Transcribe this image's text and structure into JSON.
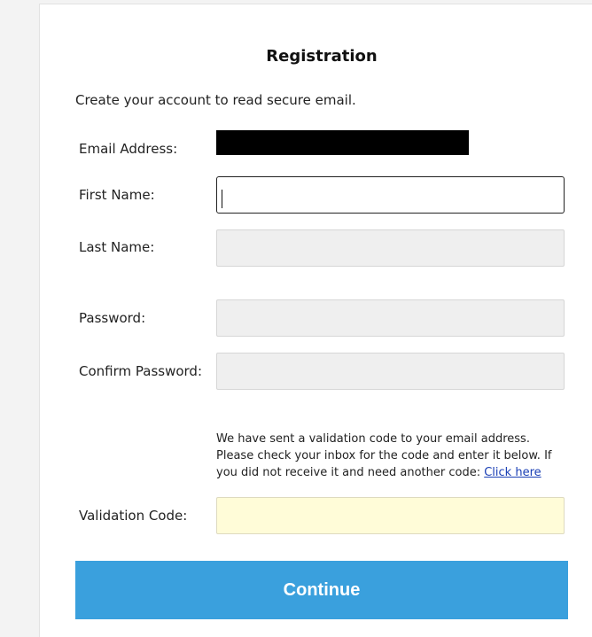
{
  "form": {
    "title": "Registration",
    "subtitle": "Create your account to read secure email.",
    "email_label": "Email Address:",
    "first_name_label": "First Name:",
    "last_name_label": "Last Name:",
    "password_label": "Password:",
    "confirm_password_label": "Confirm Password:",
    "validation_info": "We have sent a validation code to your email address. Please check your inbox for the code and enter it below. If you did not receive it and need another code: ",
    "click_here_label": "Click here",
    "validation_code_label": "Validation Code:",
    "continue_label": "Continue"
  },
  "colors": {
    "button": "#3aa0dd",
    "validation_field": "#fffcd8",
    "disabled_field": "#efefef",
    "link": "#1a3fb5"
  }
}
